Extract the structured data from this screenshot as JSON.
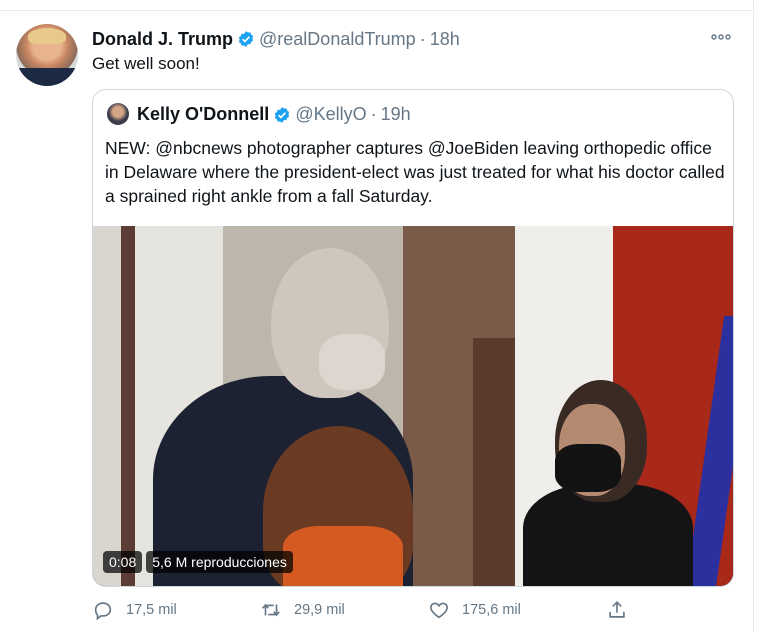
{
  "tweet": {
    "author_name": "Donald J. Trump",
    "handle": "@realDonaldTrump",
    "separator": "·",
    "time": "18h",
    "more_icon": "more-icon",
    "text": "Get well soon!"
  },
  "quoted": {
    "author_name": "Kelly O'Donnell",
    "handle": "@KellyO",
    "separator": "·",
    "time": "19h",
    "text": "NEW:  @nbcnews photographer captures @JoeBiden leaving orthopedic office in Delaware where the president-elect was just treated for what his doctor called a sprained right ankle from a fall Saturday.",
    "video": {
      "duration": "0:08",
      "views": "5,6 M reproducciones"
    }
  },
  "actions": {
    "reply_count": "17,5 mil",
    "retweet_count": "29,9 mil",
    "like_count": "175,6 mil"
  },
  "colors": {
    "verified": "#1da1f2",
    "secondary_text": "#657786",
    "border": "#ccd6dd"
  }
}
